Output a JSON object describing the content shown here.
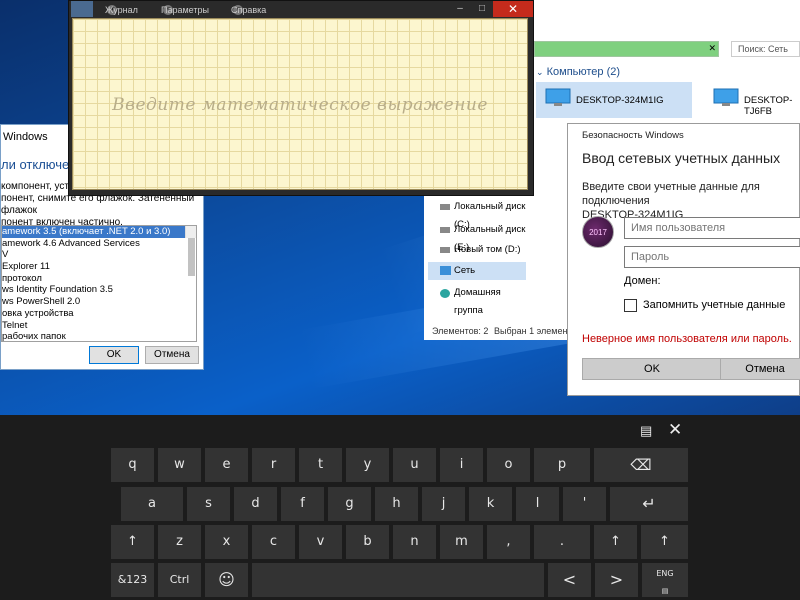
{
  "features_dialog": {
    "title": "Windows",
    "heading": "ли отключение",
    "description": [
      "компонент, устано",
      "понент, снимите его флажок. Затененный флажок",
      "понент включен частично."
    ],
    "items": [
      "amework 3.5 (включает .NET 2.0 и 3.0)",
      "amework 4.6 Advanced Services",
      "V",
      "Explorer 11",
      "протокол",
      "ws Identity Foundation 3.5",
      "ws PowerShell 2.0",
      "овка устройства",
      "Telnet",
      "рабочих папок"
    ],
    "ok": "OK",
    "cancel": "Отмена"
  },
  "math_panel": {
    "menu": [
      "Журнал",
      "Параметры",
      "Справка"
    ],
    "placeholder": "Введите математическое выражение",
    "close": "✕",
    "minimize": "–",
    "maximize": "□"
  },
  "explorer": {
    "search_placeholder": "Поиск: Сеть",
    "group_header": "Компьютер (2)",
    "computers": [
      "DESKTOP-324M1IG",
      "DESKTOP-TJ6FB"
    ],
    "nav": [
      {
        "label": "Локальный диск (C:)",
        "icon": "drive-icon"
      },
      {
        "label": "Локальный диск (E:)",
        "icon": "drive-icon"
      },
      {
        "label": "Новый том (D:)",
        "icon": "drive-icon"
      },
      {
        "label": "Сеть",
        "icon": "network-icon",
        "selected": true
      },
      {
        "label": "Домашняя группа",
        "icon": "homegroup-icon"
      }
    ],
    "status_items": "Элементов: 2",
    "status_selected": "Выбран 1 элемент"
  },
  "security_dialog": {
    "window_title": "Безопасность Windows",
    "heading": "Ввод сетевых учетных данных",
    "instruction_line1": "Введите свои учетные данные для подключения",
    "instruction_line2": "DESKTOP-324M1IG",
    "avatar_text": "2017",
    "username_placeholder": "Имя пользователя",
    "password_placeholder": "Пароль",
    "domain_label": "Домен:",
    "remember_label": "Запомнить учетные данные",
    "error": "Неверное имя пользователя или пароль.",
    "ok": "OK",
    "cancel": "Отмена",
    "error_color": "#c00000"
  },
  "keyboard": {
    "row1": [
      "q",
      "w",
      "e",
      "r",
      "t",
      "y",
      "u",
      "i",
      "o",
      "p"
    ],
    "row2": [
      "a",
      "s",
      "d",
      "f",
      "g",
      "h",
      "j",
      "k",
      "l",
      "'"
    ],
    "row3": [
      "z",
      "x",
      "c",
      "v",
      "b",
      "n",
      "m",
      ",",
      "."
    ],
    "numbers_key": "&123",
    "ctrl_key": "Ctrl",
    "lang_key": "ENG",
    "backspace_icon": "⌫",
    "enter_icon": "↵",
    "shift_icon": "↑",
    "emoji_icon": "☺",
    "left_icon": "<",
    "right_icon": ">",
    "close_icon": "✕",
    "layout_icon": "▤"
  }
}
